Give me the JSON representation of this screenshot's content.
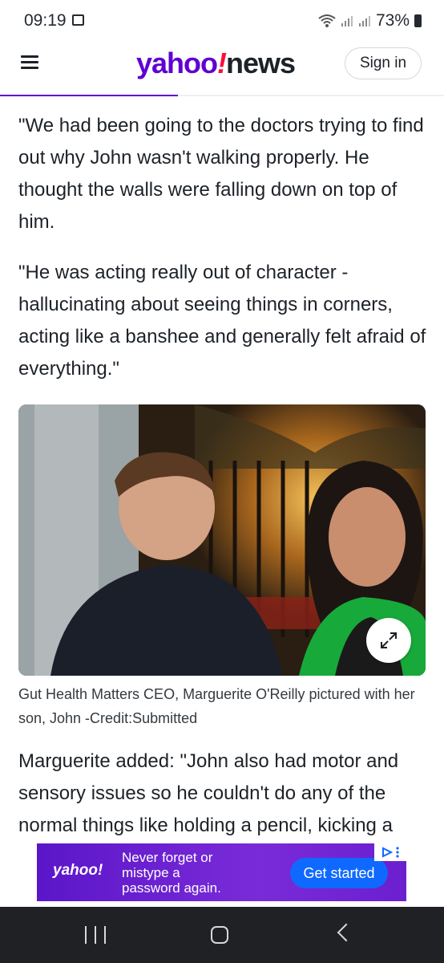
{
  "status_bar": {
    "time": "09:19",
    "battery": "73%",
    "icons": [
      "gallery-icon",
      "wifi-icon",
      "signal-icon",
      "signal-icon",
      "battery-icon"
    ]
  },
  "header": {
    "logo_yahoo": "yahoo",
    "logo_bang": "!",
    "logo_news": "news",
    "signin_label": "Sign in",
    "read_progress": 0.4
  },
  "article": {
    "paragraphs": [
      "\"We had been going to the doctors trying to find out why John wasn't walking properly. He thought the walls were falling down on top of him.",
      "\"He was acting really out of character - hallucinating about seeing things in corners, acting like a banshee and generally felt afraid of everything.\"",
      "Marguerite added: \"John also had motor and sensory issues so he couldn't do any of the normal things like holding a pencil, kicking a"
    ],
    "photo_caption": "Gut Health Matters CEO, Marguerite O'Reilly pictured with her son, John -Credit:Submitted"
  },
  "ad": {
    "logo": "yahoo!",
    "text": "Never forget or mistype a password again.",
    "cta": "Get started"
  },
  "colors": {
    "brand_purple": "#6001d2",
    "ad_button": "#0f69ff",
    "nav_background": "#202124"
  }
}
